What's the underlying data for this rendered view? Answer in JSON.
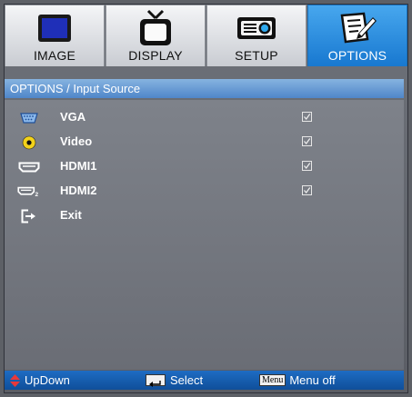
{
  "tabs": [
    {
      "label": "IMAGE",
      "icon": "monitor-icon",
      "active": false
    },
    {
      "label": "DISPLAY",
      "icon": "tv-icon",
      "active": false
    },
    {
      "label": "SETUP",
      "icon": "projector-icon",
      "active": false
    },
    {
      "label": "OPTIONS",
      "icon": "notepad-pencil-icon",
      "active": true
    }
  ],
  "title": "OPTIONS / Input Source",
  "items": [
    {
      "label": "VGA",
      "icon": "vga-port-icon",
      "checked": true
    },
    {
      "label": "Video",
      "icon": "video-rca-icon",
      "checked": true
    },
    {
      "label": "HDMI1",
      "icon": "hdmi-port-icon",
      "checked": true
    },
    {
      "label": "HDMI2",
      "icon": "hdmi-port-icon",
      "checked": true
    },
    {
      "label": "Exit",
      "icon": "exit-icon",
      "checked": false
    }
  ],
  "footer": {
    "updown_label": "UpDown",
    "select_label": "Select",
    "menu_key": "Menu",
    "menu_off_label": "Menu off"
  },
  "colors": {
    "accent": "#1878d0",
    "title_bar": "#5f93cf",
    "panel": "#74777f",
    "updown_arrow": "#e8383a"
  }
}
